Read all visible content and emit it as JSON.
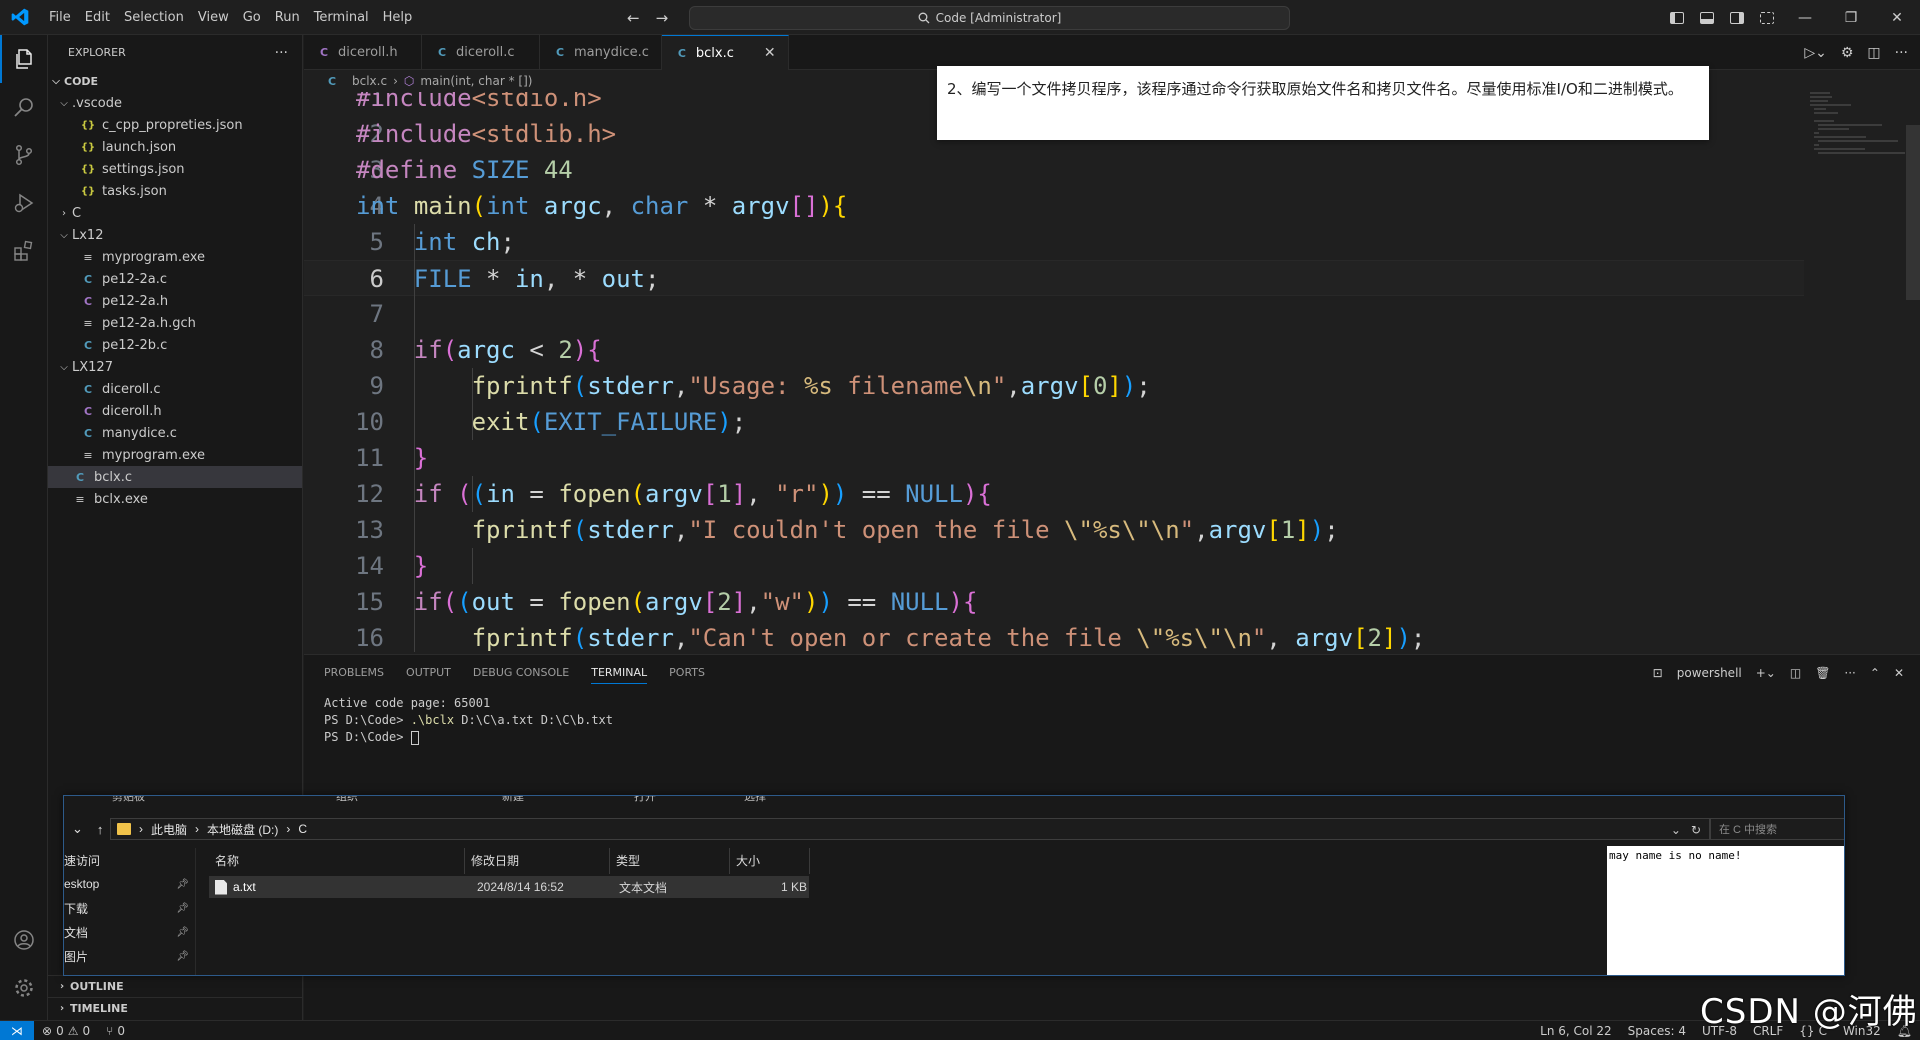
{
  "menu": [
    "File",
    "Edit",
    "Selection",
    "View",
    "Go",
    "Run",
    "Terminal",
    "Help"
  ],
  "command_center": "Code [Administrator]",
  "explorer": {
    "title": "EXPLORER",
    "root": "CODE",
    "tree": [
      {
        "type": "folder",
        "label": ".vscode",
        "depth": 1,
        "open": true
      },
      {
        "type": "json",
        "icon": "{}",
        "label": "c_cpp_propreties.json",
        "depth": 2
      },
      {
        "type": "json",
        "icon": "{}",
        "label": "launch.json",
        "depth": 2
      },
      {
        "type": "json",
        "icon": "{}",
        "label": "settings.json",
        "depth": 2
      },
      {
        "type": "json",
        "icon": "{}",
        "label": "tasks.json",
        "depth": 2
      },
      {
        "type": "folder",
        "label": "C",
        "depth": 1,
        "open": false
      },
      {
        "type": "folder",
        "label": "Lx12",
        "depth": 1,
        "open": true
      },
      {
        "type": "exe",
        "icon": "≡",
        "label": "myprogram.exe",
        "depth": 2
      },
      {
        "type": "c",
        "icon": "C",
        "label": "pe12-2a.c",
        "depth": 2
      },
      {
        "type": "h",
        "icon": "C",
        "label": "pe12-2a.h",
        "depth": 2
      },
      {
        "type": "exe",
        "icon": "≡",
        "label": "pe12-2a.h.gch",
        "depth": 2
      },
      {
        "type": "c",
        "icon": "C",
        "label": "pe12-2b.c",
        "depth": 2
      },
      {
        "type": "folder",
        "label": "LX127",
        "depth": 1,
        "open": true
      },
      {
        "type": "c",
        "icon": "C",
        "label": "diceroll.c",
        "depth": 2
      },
      {
        "type": "h",
        "icon": "C",
        "label": "diceroll.h",
        "depth": 2
      },
      {
        "type": "c",
        "icon": "C",
        "label": "manydice.c",
        "depth": 2
      },
      {
        "type": "exe",
        "icon": "≡",
        "label": "myprogram.exe",
        "depth": 2
      },
      {
        "type": "c",
        "icon": "C",
        "label": "bclx.c",
        "depth": 1,
        "selected": true
      },
      {
        "type": "exe",
        "icon": "≡",
        "label": "bclx.exe",
        "depth": 1
      }
    ],
    "outline": "OUTLINE",
    "timeline": "TIMELINE"
  },
  "tabs": [
    {
      "icon": "C",
      "kind": "h",
      "label": "diceroll.h",
      "active": false
    },
    {
      "icon": "C",
      "kind": "c",
      "label": "diceroll.c",
      "active": false
    },
    {
      "icon": "C",
      "kind": "c",
      "label": "manydice.c",
      "active": false
    },
    {
      "icon": "C",
      "kind": "c",
      "label": "bclx.c",
      "active": true,
      "close": "✕"
    }
  ],
  "breadcrumb": {
    "file": "bclx.c",
    "symbol": "main(int, char * [])"
  },
  "notice": "2、编写一个文件拷贝程序，该程序通过命令行获取原始文件名和拷贝文件名。尽量使用标准I/O和二进制模式。",
  "editor": {
    "current_line": 6,
    "lines": [
      {
        "n": "1",
        "indent": 0,
        "tokens": [
          [
            "pp",
            "#include"
          ],
          [
            "inc",
            "<stdio.h>"
          ]
        ]
      },
      {
        "n": "2",
        "indent": 0,
        "tokens": [
          [
            "pp",
            "#include"
          ],
          [
            "inc",
            "<stdlib.h>"
          ]
        ]
      },
      {
        "n": "3",
        "indent": 0,
        "tokens": [
          [
            "pp",
            "#define"
          ],
          [
            "op",
            " "
          ],
          [
            "def",
            "SIZE"
          ],
          [
            "op",
            " "
          ],
          [
            "num",
            "44"
          ]
        ]
      },
      {
        "n": "4",
        "indent": 0,
        "tokens": [
          [
            "type",
            "int"
          ],
          [
            "op",
            " "
          ],
          [
            "fn",
            "main"
          ],
          [
            "p1",
            "("
          ],
          [
            "type",
            "int"
          ],
          [
            "op",
            " "
          ],
          [
            "var",
            "argc"
          ],
          [
            "op",
            ", "
          ],
          [
            "type",
            "char"
          ],
          [
            "op",
            " * "
          ],
          [
            "var",
            "argv"
          ],
          [
            "p2",
            "[]"
          ],
          [
            "p1",
            ")"
          ],
          [
            "p1",
            "{"
          ]
        ]
      },
      {
        "n": "5",
        "indent": 1,
        "tokens": [
          [
            "type",
            "int"
          ],
          [
            "op",
            " "
          ],
          [
            "var",
            "ch"
          ],
          [
            "op",
            ";"
          ]
        ]
      },
      {
        "n": "6",
        "indent": 1,
        "tokens": [
          [
            "mac",
            "FILE"
          ],
          [
            "op",
            " * "
          ],
          [
            "var",
            "in"
          ],
          [
            "op",
            ", * "
          ],
          [
            "var",
            "out"
          ],
          [
            "op",
            ";"
          ]
        ]
      },
      {
        "n": "7",
        "indent": 0,
        "tokens": []
      },
      {
        "n": "8",
        "indent": 1,
        "tokens": [
          [
            "ctrl",
            "if"
          ],
          [
            "p2",
            "("
          ],
          [
            "var",
            "argc"
          ],
          [
            "op",
            " < "
          ],
          [
            "num",
            "2"
          ],
          [
            "p2",
            ")"
          ],
          [
            "p2",
            "{"
          ]
        ]
      },
      {
        "n": "9",
        "indent": 2,
        "tokens": [
          [
            "fn",
            "fprintf"
          ],
          [
            "p3",
            "("
          ],
          [
            "var",
            "stderr"
          ],
          [
            "op",
            ","
          ],
          [
            "str",
            "\"Usage: "
          ],
          [
            "esc",
            "%s"
          ],
          [
            "str",
            " filename"
          ],
          [
            "esc",
            "\\n"
          ],
          [
            "str",
            "\""
          ],
          [
            "op",
            ","
          ],
          [
            "var",
            "argv"
          ],
          [
            "p1",
            "["
          ],
          [
            "num",
            "0"
          ],
          [
            "p1",
            "]"
          ],
          [
            "p3",
            ")"
          ],
          [
            "op",
            ";"
          ]
        ]
      },
      {
        "n": "10",
        "indent": 2,
        "tokens": [
          [
            "fn",
            "exit"
          ],
          [
            "p3",
            "("
          ],
          [
            "mac",
            "EXIT_FAILURE"
          ],
          [
            "p3",
            ")"
          ],
          [
            "op",
            ";"
          ]
        ]
      },
      {
        "n": "11",
        "indent": 1,
        "tokens": [
          [
            "p2",
            "}"
          ]
        ]
      },
      {
        "n": "12",
        "indent": 1,
        "tokens": [
          [
            "ctrl",
            "if"
          ],
          [
            "op",
            " "
          ],
          [
            "p2",
            "("
          ],
          [
            "p3",
            "("
          ],
          [
            "var",
            "in"
          ],
          [
            "op",
            " = "
          ],
          [
            "fn",
            "fopen"
          ],
          [
            "p1",
            "("
          ],
          [
            "var",
            "argv"
          ],
          [
            "p2",
            "["
          ],
          [
            "num",
            "1"
          ],
          [
            "p2",
            "]"
          ],
          [
            "op",
            ", "
          ],
          [
            "str",
            "\"r\""
          ],
          [
            "p1",
            ")"
          ],
          [
            "p3",
            ")"
          ],
          [
            "op",
            " == "
          ],
          [
            "mac",
            "NULL"
          ],
          [
            "p2",
            ")"
          ],
          [
            "p2",
            "{"
          ]
        ]
      },
      {
        "n": "13",
        "indent": 2,
        "tokens": [
          [
            "fn",
            "fprintf"
          ],
          [
            "p3",
            "("
          ],
          [
            "var",
            "stderr"
          ],
          [
            "op",
            ","
          ],
          [
            "str",
            "\"I couldn't open the file "
          ],
          [
            "esc",
            "\\\""
          ],
          [
            "esc",
            "%s"
          ],
          [
            "esc",
            "\\\""
          ],
          [
            "esc",
            "\\n"
          ],
          [
            "str",
            "\""
          ],
          [
            "op",
            ","
          ],
          [
            "var",
            "argv"
          ],
          [
            "p1",
            "["
          ],
          [
            "num",
            "1"
          ],
          [
            "p1",
            "]"
          ],
          [
            "p3",
            ")"
          ],
          [
            "op",
            ";"
          ]
        ]
      },
      {
        "n": "14",
        "indent": 1,
        "tokens": [
          [
            "p2",
            "}"
          ]
        ]
      },
      {
        "n": "15",
        "indent": 1,
        "tokens": [
          [
            "ctrl",
            "if"
          ],
          [
            "p2",
            "("
          ],
          [
            "p3",
            "("
          ],
          [
            "var",
            "out"
          ],
          [
            "op",
            " = "
          ],
          [
            "fn",
            "fopen"
          ],
          [
            "p1",
            "("
          ],
          [
            "var",
            "argv"
          ],
          [
            "p2",
            "["
          ],
          [
            "num",
            "2"
          ],
          [
            "p2",
            "]"
          ],
          [
            "op",
            ","
          ],
          [
            "str",
            "\"w\""
          ],
          [
            "p1",
            ")"
          ],
          [
            "p3",
            ")"
          ],
          [
            "op",
            " == "
          ],
          [
            "mac",
            "NULL"
          ],
          [
            "p2",
            ")"
          ],
          [
            "p2",
            "{"
          ]
        ]
      },
      {
        "n": "16",
        "indent": 2,
        "tokens": [
          [
            "fn",
            "fprintf"
          ],
          [
            "p3",
            "("
          ],
          [
            "var",
            "stderr"
          ],
          [
            "op",
            ","
          ],
          [
            "str",
            "\"Can't open or create the file "
          ],
          [
            "esc",
            "\\\""
          ],
          [
            "esc",
            "%s"
          ],
          [
            "esc",
            "\\\""
          ],
          [
            "esc",
            "\\n"
          ],
          [
            "str",
            "\""
          ],
          [
            "op",
            ", "
          ],
          [
            "var",
            "argv"
          ],
          [
            "p1",
            "["
          ],
          [
            "num",
            "2"
          ],
          [
            "p1",
            "]"
          ],
          [
            "p3",
            ")"
          ],
          [
            "op",
            ";"
          ]
        ]
      }
    ]
  },
  "panel": {
    "tabs": [
      "PROBLEMS",
      "OUTPUT",
      "DEBUG CONSOLE",
      "TERMINAL",
      "PORTS"
    ],
    "active_tab": "TERMINAL",
    "shell": "powershell",
    "terminal_lines": [
      "Active code page: 65001",
      "PS D:\\Code> ",
      "PS D:\\Code> "
    ],
    "cmd_exe": ".\\bclx",
    "cmd_args": " D:\\C\\a.txt D:\\C\\b.txt"
  },
  "file_explorer": {
    "ribbon": [
      "剪贴板",
      "组织",
      "新建",
      "打开",
      "选择"
    ],
    "path": [
      "此电脑",
      "本地磁盘 (D:)",
      "C"
    ],
    "search_placeholder": "在 C 中搜索",
    "nav_items": [
      {
        "label": "速访问",
        "pin": false
      },
      {
        "label": "esktop",
        "pin": true
      },
      {
        "label": "下载",
        "pin": true
      },
      {
        "label": "文档",
        "pin": true
      },
      {
        "label": "图片",
        "pin": true
      }
    ],
    "columns": [
      "名称",
      "修改日期",
      "类型",
      "大小"
    ],
    "files": [
      {
        "name": "a.txt",
        "modified": "2024/8/14 16:52",
        "type": "文本文档",
        "size": "1 KB"
      }
    ],
    "preview_text": "may name is no name!"
  },
  "status": {
    "errors": "0",
    "warnings": "0",
    "ports": "0",
    "position": "Ln 6, Col 22",
    "spaces": "Spaces: 4",
    "encoding": "UTF-8",
    "eol": "CRLF",
    "language": "C",
    "platform": "Win32"
  },
  "watermark": "CSDN @河佛"
}
